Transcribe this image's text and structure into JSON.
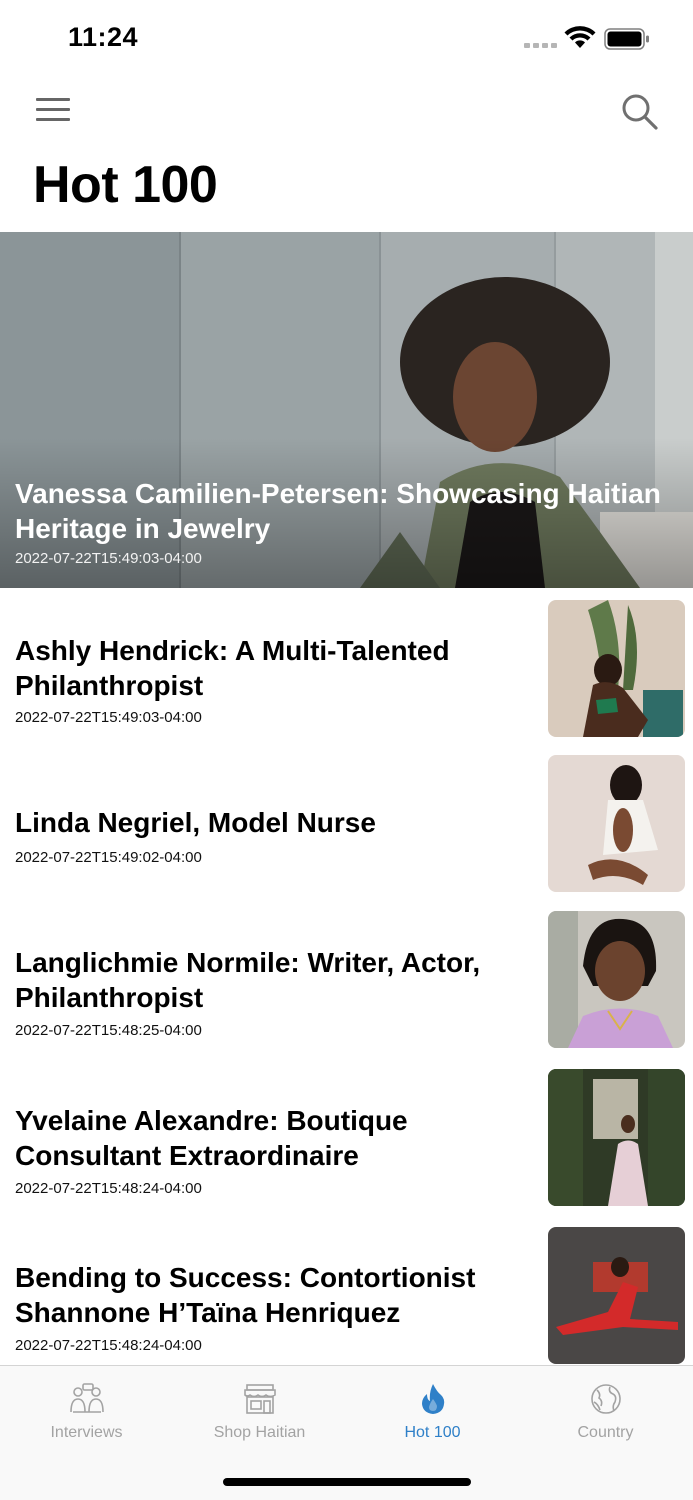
{
  "status_bar": {
    "time": "11:24"
  },
  "header": {
    "title": "Hot 100",
    "menu_icon": "hamburger-menu-icon",
    "search_icon": "search-icon"
  },
  "featured": {
    "title": "Vanessa Camilien-Petersen: Showcasing Haitian Heritage in Jewelry",
    "date": "2022-07-22T15:49:03-04:00"
  },
  "articles": [
    {
      "title": "Ashly Hendrick: A Multi-Talented Philanthropist",
      "date": "2022-07-22T15:49:03-04:00"
    },
    {
      "title": "Linda Negriel, Model Nurse",
      "date": "2022-07-22T15:49:02-04:00"
    },
    {
      "title": "Langlichmie Normile: Writer, Actor, Philanthropist",
      "date": "2022-07-22T15:48:25-04:00"
    },
    {
      "title": "Yvelaine Alexandre: Boutique Consultant Extraordinaire",
      "date": "2022-07-22T15:48:24-04:00"
    },
    {
      "title": "Bending to Success: Contortionist Shannone H’Taïna Henriquez",
      "date": "2022-07-22T15:48:24-04:00"
    }
  ],
  "tabs": [
    {
      "label": "Interviews",
      "icon": "interview-icon",
      "active": false
    },
    {
      "label": "Shop Haitian",
      "icon": "storefront-icon",
      "active": false
    },
    {
      "label": "Hot 100",
      "icon": "flame-icon",
      "active": true
    },
    {
      "label": "Country",
      "icon": "globe-icon",
      "active": false
    }
  ],
  "colors": {
    "accent": "#2f80c8",
    "inactive_tab": "#a3a3a3"
  }
}
